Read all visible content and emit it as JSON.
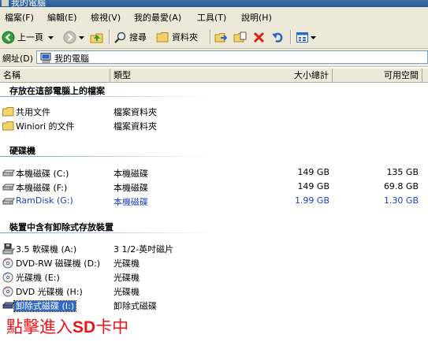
{
  "window": {
    "title": "我的電腦"
  },
  "menu": [
    {
      "label": "檔案(F)"
    },
    {
      "label": "編輯(E)"
    },
    {
      "label": "檢視(V)"
    },
    {
      "label": "我的最愛(A)"
    },
    {
      "label": "工具(T)"
    },
    {
      "label": "說明(H)"
    }
  ],
  "toolbar": {
    "back_label": "上一頁",
    "search_label": "搜尋",
    "folders_label": "資料夾"
  },
  "address": {
    "label": "網址(D)",
    "value": "我的電腦"
  },
  "columns": {
    "name": "名稱",
    "type": "類型",
    "total": "大小總計",
    "free": "可用空間"
  },
  "groups": {
    "files": {
      "title": "存放在這部電腦上的檔案",
      "items": [
        {
          "name": "共用文件",
          "type": "檔案資料夾",
          "icon": "folder-icon"
        },
        {
          "name": "Winiori 的文件",
          "type": "檔案資料夾",
          "icon": "folder-icon"
        }
      ]
    },
    "hdd": {
      "title": "硬碟機",
      "items": [
        {
          "name": "本機磁碟 (C:)",
          "type": "本機磁碟",
          "total": "149 GB",
          "free": "135 GB",
          "icon": "hard-drive-icon"
        },
        {
          "name": "本機磁碟 (F:)",
          "type": "本機磁碟",
          "total": "149 GB",
          "free": "69.8 GB",
          "icon": "hard-drive-icon"
        },
        {
          "name": "RamDisk (G:)",
          "type": "本機磁碟",
          "total": "1.99 GB",
          "free": "1.30 GB",
          "icon": "hard-drive-icon",
          "color": "#1a3fc4"
        }
      ]
    },
    "removable": {
      "title": "裝置中含有卸除式存放裝置",
      "items": [
        {
          "name": "3.5 軟碟機 (A:)",
          "type": "3 1/2-英吋磁片",
          "icon": "floppy-drive-icon"
        },
        {
          "name": "DVD-RW 磁碟機 (D:)",
          "type": "光碟機",
          "icon": "dvd-drive-icon"
        },
        {
          "name": "光碟機 (E:)",
          "type": "光碟機",
          "icon": "cd-drive-icon"
        },
        {
          "name": "DVD 光碟機 (H:)",
          "type": "光碟機",
          "icon": "dvd-drive-icon"
        },
        {
          "name": "卸除式磁碟 (I:)",
          "type": "卸除式磁碟",
          "icon": "removable-disk-icon",
          "selected": true
        }
      ]
    }
  },
  "annotation": {
    "prefix": "點擊進入",
    "bold": "SD",
    "suffix": "卡中",
    "color": "#e8161b"
  },
  "colors": {
    "menu_bg": "#ece9d8",
    "selection": "#316ac5",
    "highlight_text": "#1a3fc4"
  }
}
